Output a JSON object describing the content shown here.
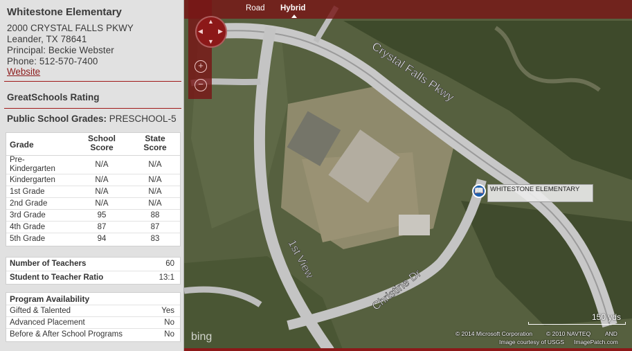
{
  "school": {
    "name": "Whitestone Elementary",
    "address_line1": "2000 CRYSTAL FALLS PKWY",
    "address_line2": "Leander, TX 78641",
    "principal": "Principal: Beckie Webster",
    "phone": "Phone: 512-570-7400",
    "website_label": "Website"
  },
  "rating": {
    "heading": "GreatSchools Rating",
    "grades_label": "Public School Grades:",
    "grades_value": "PRESCHOOL-5"
  },
  "grades_table": {
    "col_grade": "Grade",
    "col_school_1": "School",
    "col_school_2": "Score",
    "col_state_1": "State",
    "col_state_2": "Score",
    "rows": [
      {
        "grade": "Pre-\nKindergarten",
        "school": "N/A",
        "state": "N/A"
      },
      {
        "grade": "Kindergarten",
        "school": "N/A",
        "state": "N/A"
      },
      {
        "grade": "1st Grade",
        "school": "N/A",
        "state": "N/A"
      },
      {
        "grade": "2nd Grade",
        "school": "N/A",
        "state": "N/A"
      },
      {
        "grade": "3rd Grade",
        "school": "95",
        "state": "88"
      },
      {
        "grade": "4th Grade",
        "school": "87",
        "state": "87"
      },
      {
        "grade": "5th Grade",
        "school": "94",
        "state": "83"
      }
    ]
  },
  "teachers": {
    "count_label": "Number of Teachers",
    "count_value": "60",
    "ratio_label": "Student to Teacher Ratio",
    "ratio_value": "13:1"
  },
  "programs": {
    "heading": "Program Availability",
    "items": [
      {
        "label": "Gifted & Talented",
        "value": "Yes"
      },
      {
        "label": "Advanced Placement",
        "value": "No"
      },
      {
        "label": "Before & After School Programs",
        "value": "No"
      }
    ]
  },
  "map": {
    "tabs": [
      "Road",
      "Hybrid"
    ],
    "selected_tab": "Hybrid",
    "road_labels": [
      "Crystal Falls Pkwy",
      "1st View",
      "Christine Dr"
    ],
    "marker_label": "WHITESTONE ELEMENTARY",
    "scale_label": "150 yds",
    "credit_1": "© 2014 Microsoft Corporation",
    "credit_2": "© 2010 NAVTEQ",
    "credit_3": "AND",
    "credit_4": "Image courtesy of USGS",
    "credit_5": "ImagePatch.com",
    "bing_label": "bing",
    "compass_arrows": [
      "▲",
      "▼",
      "◀",
      "▶"
    ],
    "zoom_in": "+",
    "zoom_out": "−",
    "marker_glyph": "📖"
  },
  "colors": {
    "accent": "#8c1818",
    "panel_bg": "#e1e1e1",
    "marker": "#1a5fb0"
  }
}
